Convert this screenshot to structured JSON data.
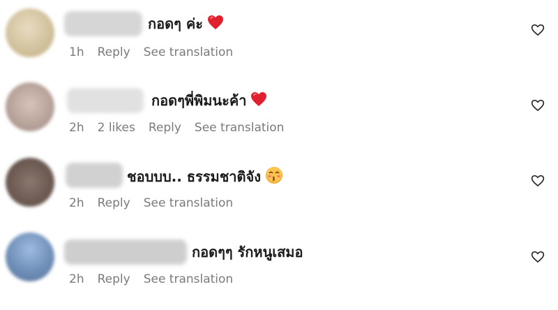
{
  "comments": [
    {
      "text": "กอดๆ ค่ะ",
      "emoji": "heart-emoji",
      "time": "1h",
      "likes": "",
      "reply": "Reply",
      "see_translation": "See translation",
      "avatar_color": "#d9ccb0",
      "username_color": "#cfcfcf"
    },
    {
      "text": "กอดๆพี่พิมนะค้า",
      "emoji": "heart-emoji",
      "time": "2h",
      "likes": "2 likes",
      "reply": "Reply",
      "see_translation": "See translation",
      "avatar_color": "#b9a49c",
      "username_color": "#d8d8d8"
    },
    {
      "text": "ชอบบบ.. ธรรมชาติจัง",
      "emoji": "kissing-face-emoji",
      "time": "2h",
      "likes": "",
      "reply": "Reply",
      "see_translation": "See translation",
      "avatar_color": "#6e5c54",
      "username_color": "#c9c9c9"
    },
    {
      "text": "กอดๆๆ รักหนูเสมอ",
      "emoji": "",
      "time": "2h",
      "likes": "",
      "reply": "Reply",
      "see_translation": "See translation",
      "avatar_color": "#6f8fb8",
      "username_color": "#c6c6c6"
    }
  ],
  "colors": {
    "heart_emoji": "#e0202e",
    "meta_text": "#7a7a7a",
    "comment_text": "#1a1a1a"
  }
}
